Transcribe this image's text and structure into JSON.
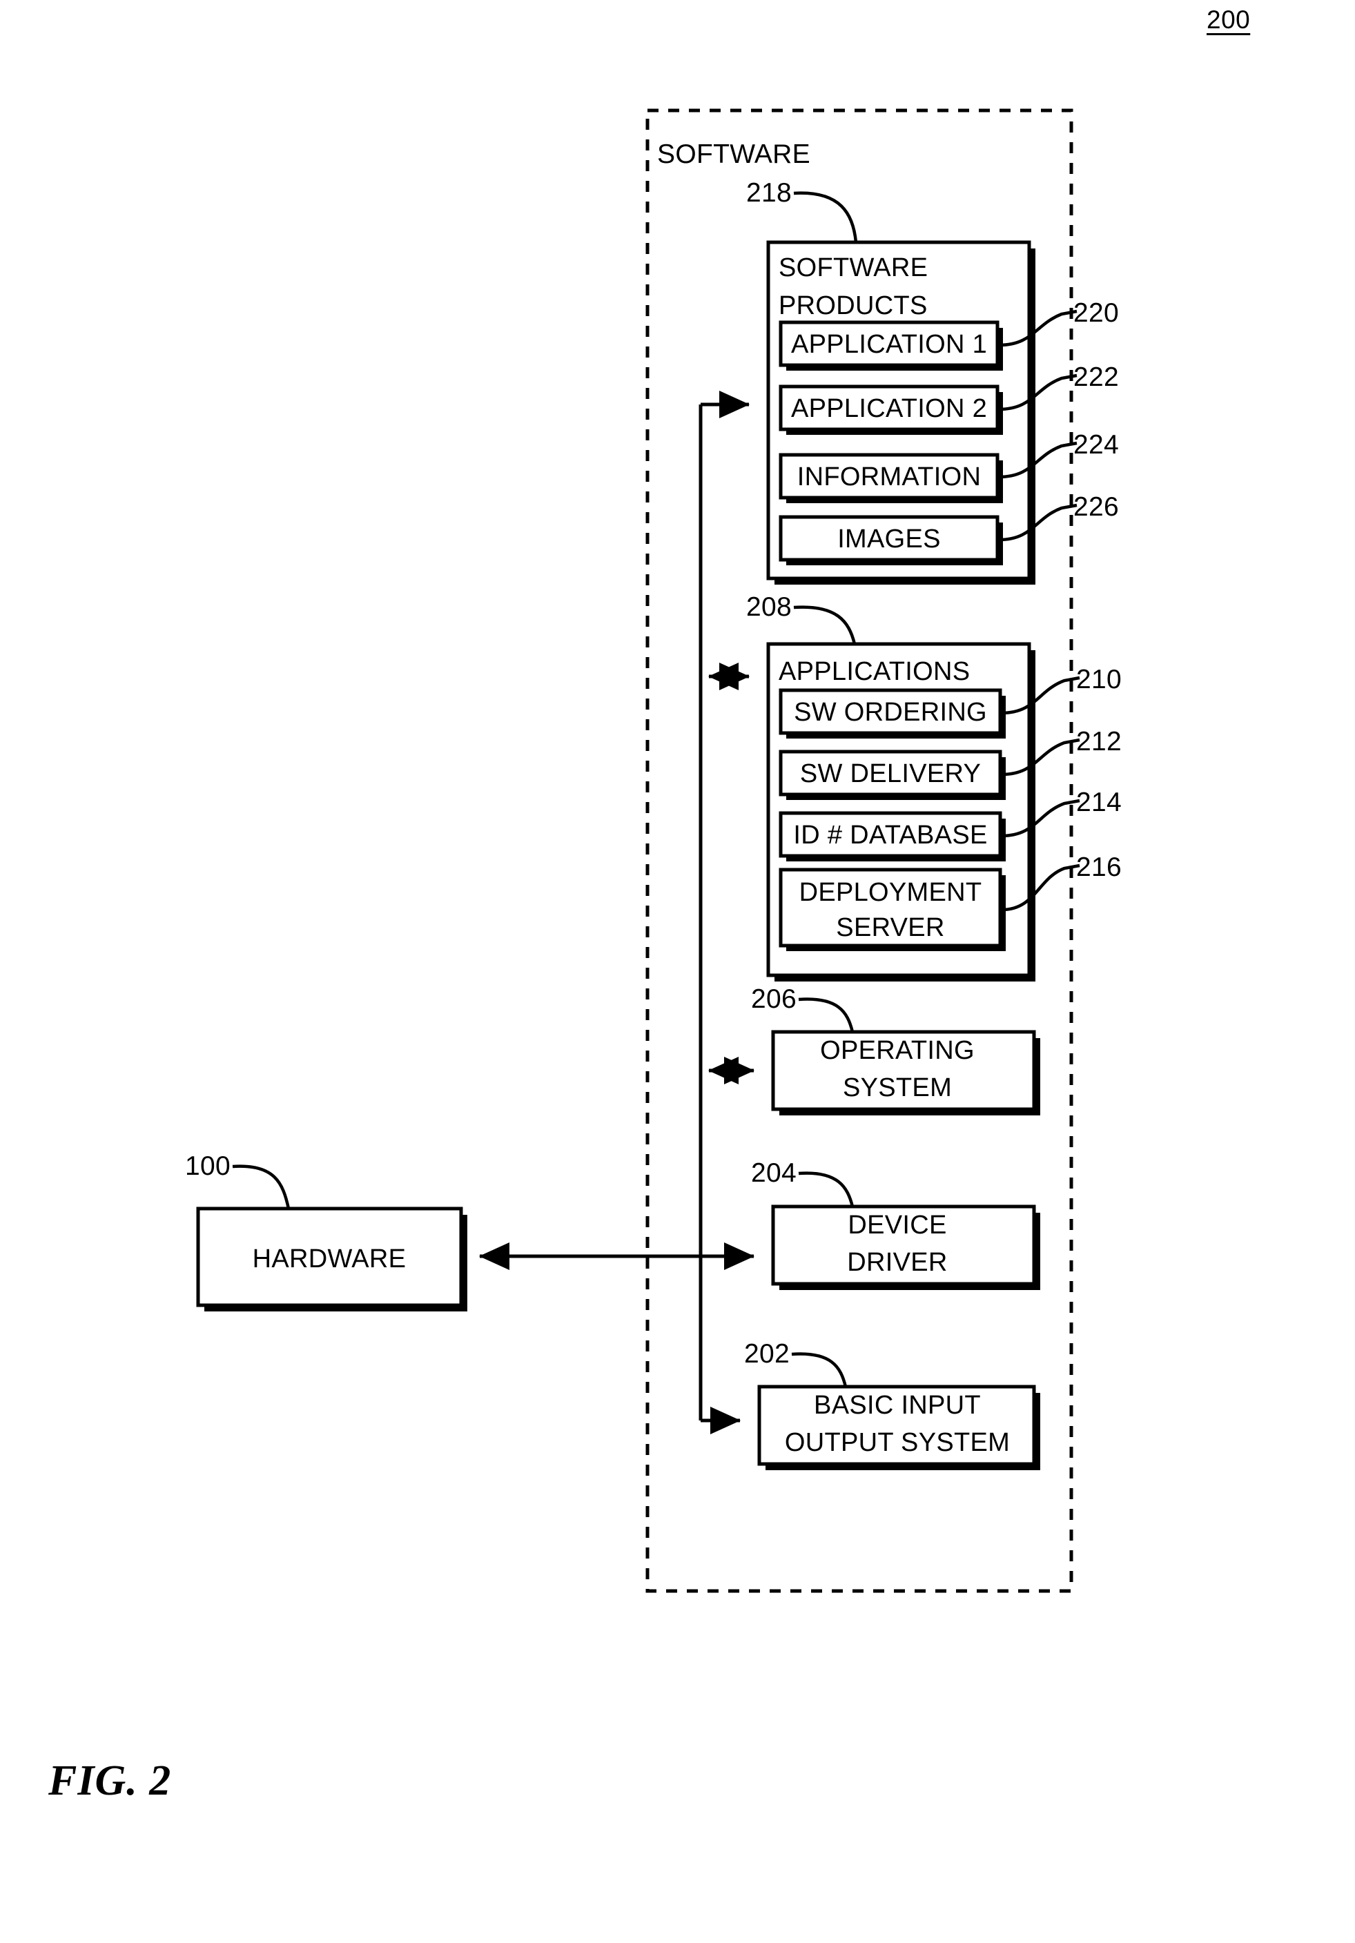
{
  "figure": {
    "caption": "FIG. 2",
    "top_reference": "200"
  },
  "software_boundary": {
    "label": "SOFTWARE"
  },
  "blocks": {
    "hardware": {
      "label": "HARDWARE",
      "ref": "100"
    },
    "software_products": {
      "title_line1": "SOFTWARE",
      "title_line2": "PRODUCTS",
      "ref": "218",
      "items": [
        {
          "label": "APPLICATION 1",
          "ref": "220"
        },
        {
          "label": "APPLICATION 2",
          "ref": "222"
        },
        {
          "label": "INFORMATION",
          "ref": "224"
        },
        {
          "label": "IMAGES",
          "ref": "226"
        }
      ]
    },
    "applications": {
      "title": "APPLICATIONS",
      "ref": "208",
      "items": [
        {
          "label": "SW ORDERING",
          "ref": "210"
        },
        {
          "label": "SW DELIVERY",
          "ref": "212"
        },
        {
          "label": "ID # DATABASE",
          "ref": "214"
        },
        {
          "label_line1": "DEPLOYMENT",
          "label_line2": "SERVER",
          "ref": "216"
        }
      ]
    },
    "operating_system": {
      "label_line1": "OPERATING",
      "label_line2": "SYSTEM",
      "ref": "206"
    },
    "device_driver": {
      "label_line1": "DEVICE",
      "label_line2": "DRIVER",
      "ref": "204"
    },
    "bios": {
      "label_line1": "BASIC INPUT",
      "label_line2": "OUTPUT SYSTEM",
      "ref": "202"
    }
  },
  "colors": {
    "stroke": "#000000",
    "fill": "#ffffff",
    "background": "#ffffff"
  }
}
